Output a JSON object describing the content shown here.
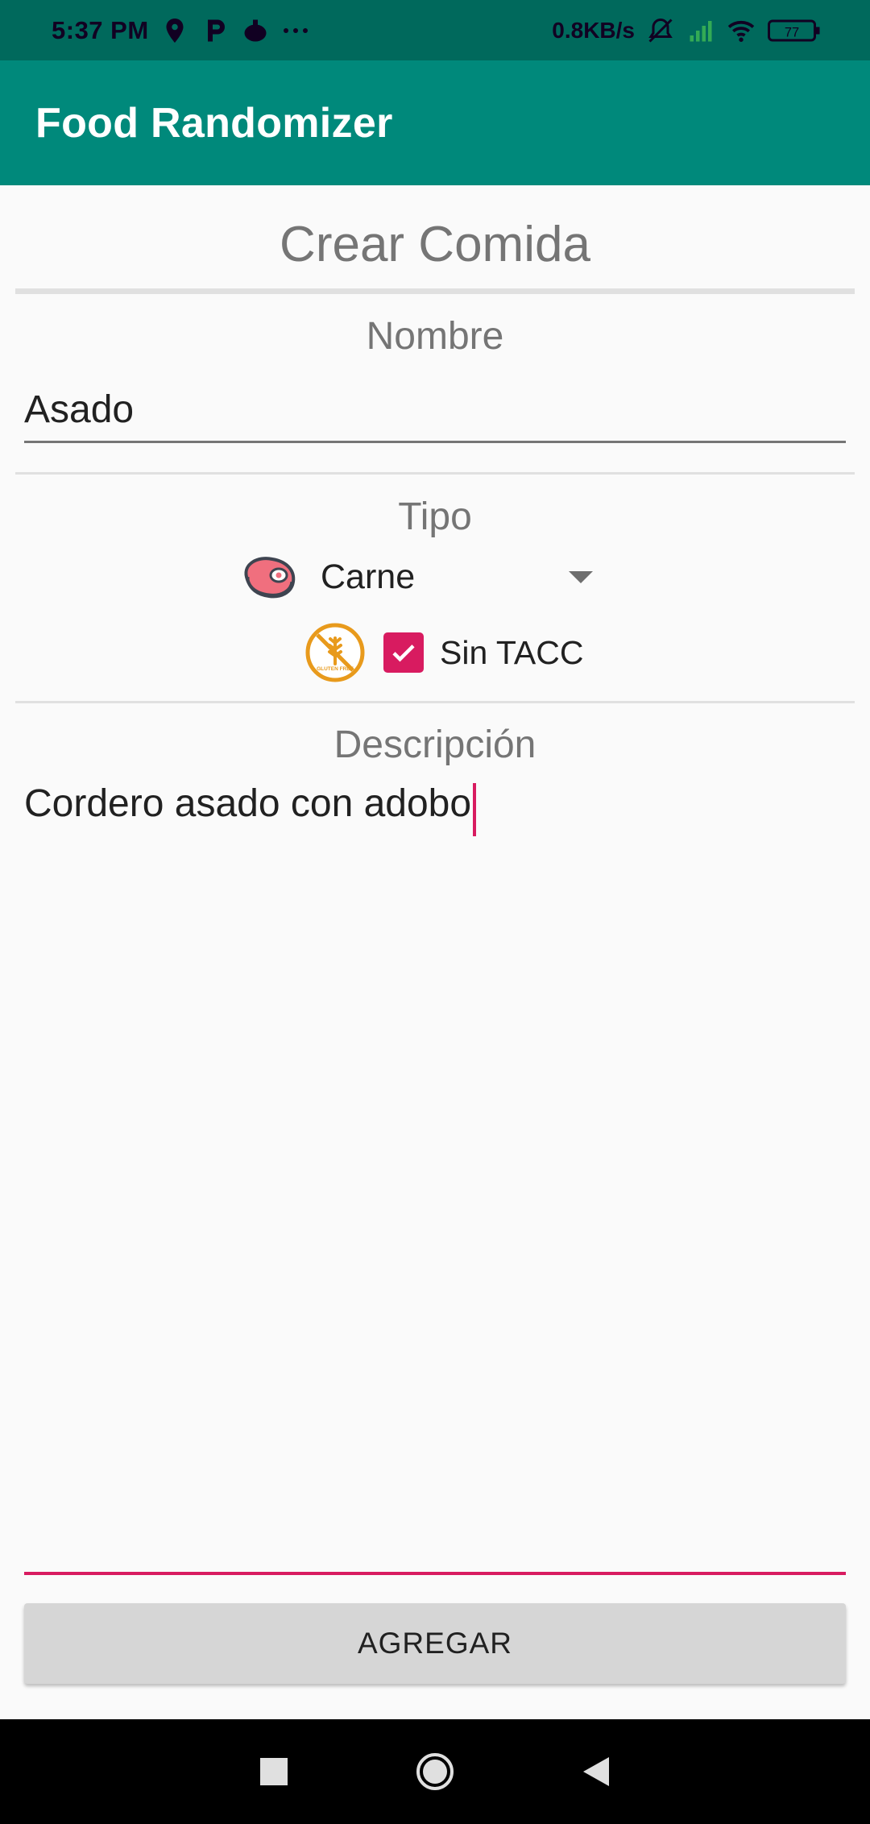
{
  "status_bar": {
    "time": "5:37 PM",
    "net_rate": "0.8KB/s",
    "battery": "77",
    "icons": [
      "location-icon",
      "parking-icon",
      "notification-app-icon",
      "more-dots-icon",
      "mute-icon",
      "signal-icon",
      "wifi-icon",
      "battery-icon"
    ]
  },
  "app_bar": {
    "title": "Food Randomizer"
  },
  "form": {
    "title": "Crear Comida",
    "nombre_label": "Nombre",
    "nombre_value": "Asado",
    "tipo_label": "Tipo",
    "tipo_selected": "Carne",
    "tipo_icon": "meat-steak-icon",
    "sin_tacc_label": "Sin TACC",
    "sin_tacc_checked": true,
    "gluten_free_icon": "gluten-free-icon",
    "gluten_free_badge_text": "GLUTEN FREE",
    "descripcion_label": "Descripción",
    "descripcion_value": "Cordero asado con adobo",
    "add_button": "AGREGAR"
  },
  "nav_bar": {
    "buttons": [
      "recents-square-icon",
      "home-circle-icon",
      "back-triangle-icon"
    ]
  },
  "colors": {
    "status_bar": "#00695C",
    "app_bar": "#00897B",
    "accent": "#D81B60",
    "background": "#FAFAFA"
  }
}
